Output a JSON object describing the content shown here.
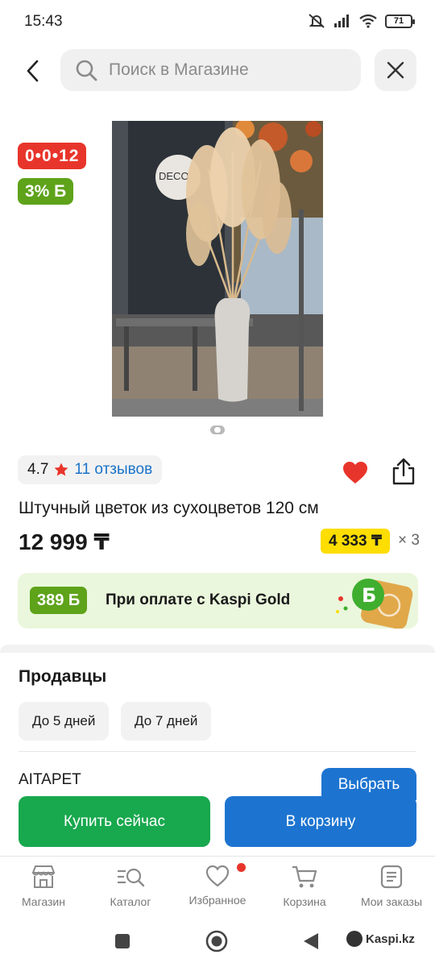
{
  "status": {
    "time": "15:43",
    "battery": "71"
  },
  "search": {
    "placeholder": "Поиск в Магазине"
  },
  "product": {
    "timer_badge": "0•0•12",
    "bonus_badge": "3% Б",
    "rating": "4.7",
    "reviews": "11 отзывов",
    "title": "Штучный цветок из сухоцветов 120 см",
    "price": "12 999 ₸",
    "installment": "4 333 ₸",
    "installment_multiplier": "× 3",
    "image_sign_text": "DECO"
  },
  "gold": {
    "bonus": "389 Б",
    "text": "При оплате с Kaspi Gold"
  },
  "sellers": {
    "title": "Продавцы",
    "chips": [
      {
        "label": "До 5 дней"
      },
      {
        "label": "До 7 дней"
      }
    ],
    "seller_name": "AITAPET",
    "choose_label": "Выбрать"
  },
  "actions": {
    "buy_now": "Купить сейчас",
    "add_to_cart": "В корзину"
  },
  "nav": {
    "items": [
      {
        "label": "Магазин",
        "icon": "store-icon"
      },
      {
        "label": "Каталог",
        "icon": "catalog-icon"
      },
      {
        "label": "Избранное",
        "icon": "heart-outline-icon"
      },
      {
        "label": "Корзина",
        "icon": "cart-icon"
      },
      {
        "label": "Мои заказы",
        "icon": "orders-icon"
      }
    ]
  },
  "watermark": "Kaspi.kz",
  "colors": {
    "red": "#e8352b",
    "green": "#5ea31a",
    "blue": "#1d74d0",
    "buy_green": "#18a84e",
    "yellow": "#fedd00"
  }
}
